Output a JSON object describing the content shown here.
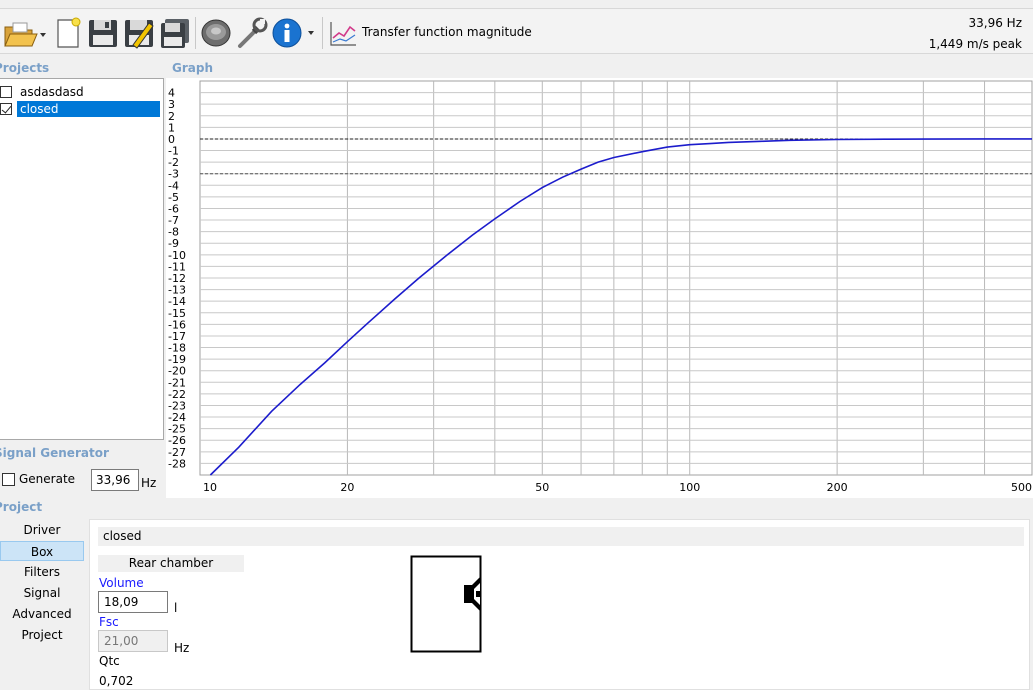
{
  "toolbar": {
    "icons": [
      "open-folder-icon",
      "new-file-icon",
      "save-icon",
      "save-as-icon",
      "save-all-icon",
      "speaker-icon",
      "wrench-icon",
      "info-icon",
      "graph-icon"
    ],
    "view_label": "Transfer function magnitude",
    "frequency_readout": "33,96 Hz",
    "peak_readout": "1,449 m/s peak"
  },
  "projects": {
    "title": "Projects",
    "items": [
      {
        "label": "asdasdasd",
        "checked": false,
        "selected": false
      },
      {
        "label": "closed",
        "checked": true,
        "selected": true
      }
    ]
  },
  "graph": {
    "title": "Graph"
  },
  "signal_generator": {
    "title": "Signal Generator",
    "generate_label": "Generate",
    "frequency_value": "33,96",
    "frequency_unit": "Hz"
  },
  "project_nav": {
    "title": "Project",
    "items": [
      "Driver",
      "Box",
      "Filters",
      "Signal",
      "Advanced",
      "Project"
    ],
    "active": "Box"
  },
  "box_panel": {
    "name": "closed",
    "group_title": "Rear chamber",
    "volume_label": "Volume",
    "volume_value": "18,09",
    "volume_unit": "l",
    "fsc_label": "Fsc",
    "fsc_value": "21,00",
    "fsc_unit": "Hz",
    "qtc_label": "Qtc",
    "qtc_value": "0,702"
  },
  "colors": {
    "curve": "#1c1ccc",
    "selection": "#0078d7",
    "section_title": "#7aa0c8",
    "param_label": "#1a1aff"
  },
  "chart_data": {
    "type": "line",
    "title": "",
    "xlabel": "",
    "ylabel": "",
    "x_scale": "log",
    "xlim": [
      10,
      500
    ],
    "ylim": [
      -29,
      5
    ],
    "x_ticks": [
      10,
      20,
      50,
      100,
      200,
      500
    ],
    "y_ticks": [
      4,
      3,
      2,
      1,
      0,
      -1,
      -2,
      -3,
      -4,
      -5,
      -6,
      -7,
      -8,
      -9,
      -10,
      -11,
      -12,
      -13,
      -14,
      -15,
      -16,
      -17,
      -18,
      -19,
      -20,
      -21,
      -22,
      -23,
      -24,
      -25,
      -26,
      -27,
      -28
    ],
    "reference_lines": [
      0,
      -3
    ],
    "grid": true,
    "series": [
      {
        "x": [
          10.5,
          12,
          14,
          16,
          18,
          20,
          22,
          25,
          28,
          32,
          36,
          40,
          45,
          50,
          55,
          60,
          65,
          70,
          80,
          90,
          100,
          110,
          120,
          140,
          160,
          200,
          250,
          300,
          400,
          500
        ],
        "y": [
          -29.6,
          -26.6,
          -23.5,
          -21.2,
          -19.3,
          -17.5,
          -15.9,
          -13.8,
          -12.0,
          -10.0,
          -8.3,
          -6.9,
          -5.4,
          -4.2,
          -3.3,
          -2.6,
          -2.0,
          -1.6,
          -1.1,
          -0.7,
          -0.5,
          -0.4,
          -0.3,
          -0.2,
          -0.12,
          -0.05,
          -0.02,
          -0.01,
          0.0,
          0.0
        ]
      }
    ]
  }
}
